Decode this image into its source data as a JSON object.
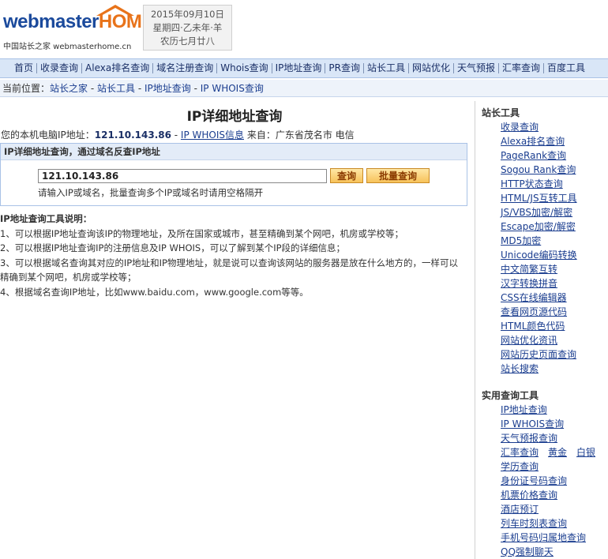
{
  "logo": {
    "word1": "webmaster",
    "word2": "HOME",
    "sub": "中国站长之家 webmasterhome.cn"
  },
  "date": {
    "line1": "2015年09月10日",
    "line2": "星期四·乙未年·羊",
    "line3": "农历七月廿八"
  },
  "topnav": [
    "首页",
    "收录查询",
    "Alexa排名查询",
    "域名注册查询",
    "Whois查询",
    "IP地址查询",
    "PR查询",
    "站长工具",
    "网站优化",
    "天气预报",
    "汇率查询",
    "百度工具"
  ],
  "breadcrumb": {
    "prefix": "当前位置：",
    "items": [
      "站长之家",
      "站长工具",
      "IP地址查询",
      "IP WHOIS查询"
    ],
    "sep": " - "
  },
  "main": {
    "title": "IP详细地址查询",
    "ip_label": "您的本机电脑IP地址：",
    "ip_value": "121.10.143.86",
    "whois_link": "IP WHOIS信息",
    "from_text": "来自：广东省茂名市 电信"
  },
  "query": {
    "header": "IP详细地址查询，通过域名反查IP地址",
    "input_value": "121.10.143.86",
    "query_button": "查询",
    "batch_button": "批量查询",
    "hint": "请输入IP或域名，批量查询多个IP或域名时请用空格隔开"
  },
  "notes": {
    "title": "IP地址查询工具说明：",
    "items": [
      "1、可以根据IP地址查询该IP的物理地址，及所在国家或城市，甚至精确到某个网吧，机房或学校等；",
      "2、可以根据IP地址查询IP的注册信息及IP WHOIS，可以了解到某个IP段的详细信息；",
      "3、可以根据域名查询其对应的IP地址和IP物理地址，就是说可以查询该网站的服务器是放在什么地方的，一样可以精确到某个网吧，机房或学校等；",
      "4、根据域名查询IP地址，比如www.baidu.com，www.google.com等等。"
    ]
  },
  "sidebar": {
    "section1_title": "站长工具",
    "section1": [
      "收录查询",
      "Alexa排名查询",
      "PageRank查询",
      "Sogou Rank查询",
      "HTTP状态查询",
      "HTML/JS互转工具",
      "JS/VBS加密/解密",
      "Escape加密/解密",
      "MD5加密",
      "Unicode编码转换",
      "中文简繁互转",
      "汉字转换拼音",
      "CSS在线编辑器",
      "查看网页源代码",
      "HTML颜色代码",
      "网站优化资讯",
      "网站历史页面查询",
      "站长搜索"
    ],
    "section2_title": "实用查询工具",
    "section2_a": [
      "IP地址查询",
      "IP WHOIS查询",
      "天气预报查询"
    ],
    "section2_row": [
      "汇率查询",
      "黄金",
      "白银"
    ],
    "section2_b": [
      "学历查询",
      "身份证号码查询",
      "机票价格查询",
      "酒店预订",
      "列车时刻表查询",
      "手机号码归属地查询",
      "QQ强制聊天"
    ]
  }
}
